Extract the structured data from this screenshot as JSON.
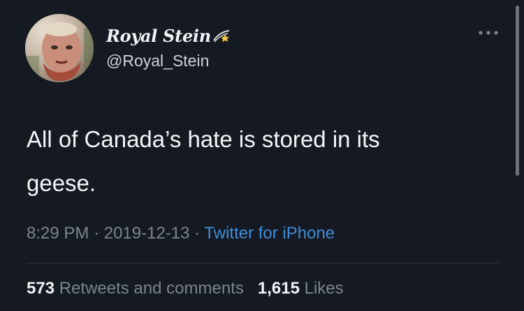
{
  "tweet": {
    "display_name": "Royal Stein",
    "handle": "@Royal_Stein",
    "text_line1": "All of Canada’s hate is stored in its",
    "text_line2": "geese.",
    "time": "8:29 PM",
    "date": "2019-12-13",
    "source": "Twitter for iPhone",
    "retweets_count": "573",
    "retweets_label": "Retweets and comments",
    "likes_count": "1,615",
    "likes_label": "Likes"
  },
  "icons": {
    "badge": "shooting-star-icon",
    "menu": "more-icon"
  },
  "colors": {
    "background": "#141922",
    "text_primary": "#f5f6f7",
    "text_secondary": "#7c848e",
    "link": "#3f8ed8",
    "divider": "#2a313b"
  }
}
